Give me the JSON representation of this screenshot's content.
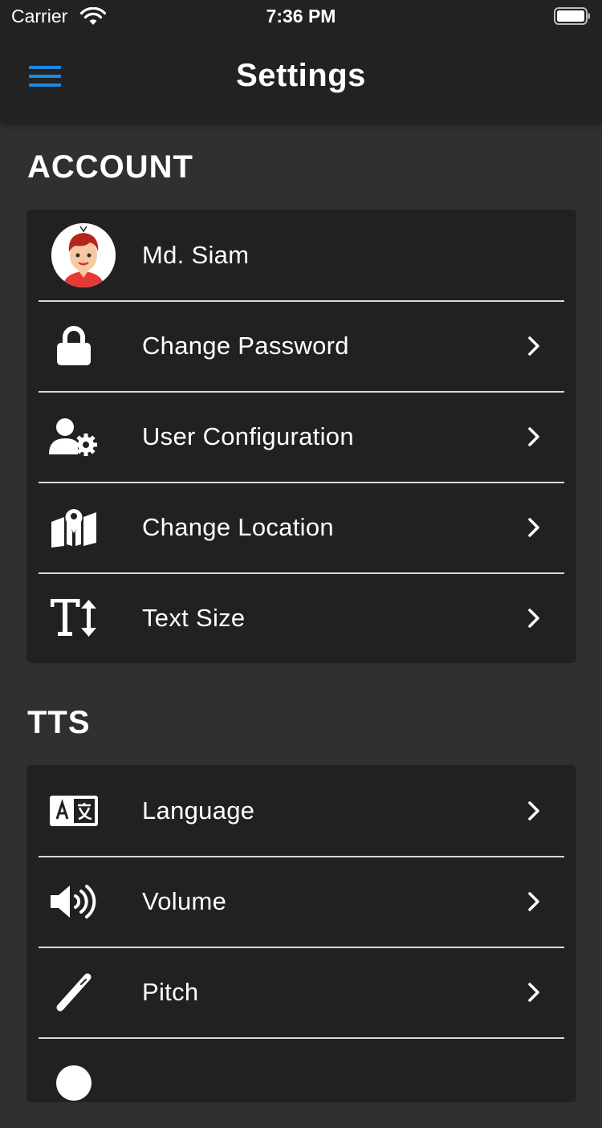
{
  "status_bar": {
    "carrier": "Carrier",
    "time": "7:36 PM"
  },
  "nav": {
    "title": "Settings",
    "menu_icon": "hamburger-menu-icon",
    "accent_color": "#1e88e5"
  },
  "account": {
    "title": "ACCOUNT",
    "profile_name": "Md. Siam",
    "items": [
      {
        "label": "Change Password",
        "icon": "lock-icon"
      },
      {
        "label": "User Configuration",
        "icon": "user-gear-icon"
      },
      {
        "label": "Change Location",
        "icon": "map-location-icon"
      },
      {
        "label": "Text Size",
        "icon": "text-height-icon"
      }
    ]
  },
  "tts": {
    "title": "TTS",
    "items": [
      {
        "label": "Language",
        "icon": "language-icon"
      },
      {
        "label": "Volume",
        "icon": "volume-icon"
      },
      {
        "label": "Pitch",
        "icon": "pitch-icon"
      }
    ]
  },
  "colors": {
    "background": "#303030",
    "card": "#212121",
    "bar": "#222222",
    "divider": "#d9d9d9"
  }
}
